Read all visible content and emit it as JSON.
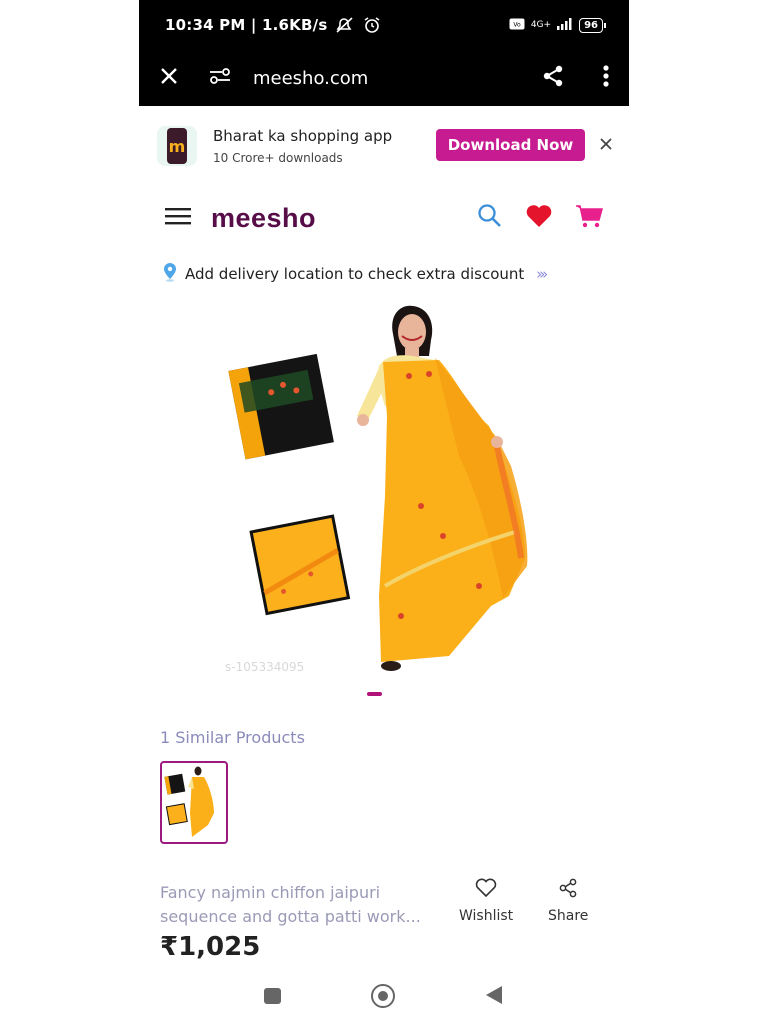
{
  "status_bar": {
    "time": "10:34 PM | 1.6KB/s",
    "network": "4G+",
    "battery": "96"
  },
  "url_bar": {
    "url": "meesho.com",
    "icons": [
      "close-icon",
      "site-settings-icon",
      "share-icon",
      "more-vertical-icon"
    ]
  },
  "app_banner": {
    "logo_letter": "m",
    "title": "Bharat ka shopping app",
    "subtitle": "10 Crore+ downloads",
    "cta": "Download Now",
    "accent": "#c71c91"
  },
  "header": {
    "logo": "meesho",
    "logo_color": "#570d48",
    "icons": [
      "menu-icon",
      "search-icon",
      "heart-icon",
      "cart-icon"
    ]
  },
  "delivery": {
    "text": "Add delivery location to check extra discount",
    "chevrons": "›››"
  },
  "product": {
    "watermark": "s-105334095",
    "similar_title": "1 Similar Products",
    "name_line1": "Fancy najmin chiffon jaipuri",
    "name_line2": "sequence and gotta patti work...",
    "wishlist": "Wishlist",
    "share": "Share",
    "price": "₹1,025"
  }
}
